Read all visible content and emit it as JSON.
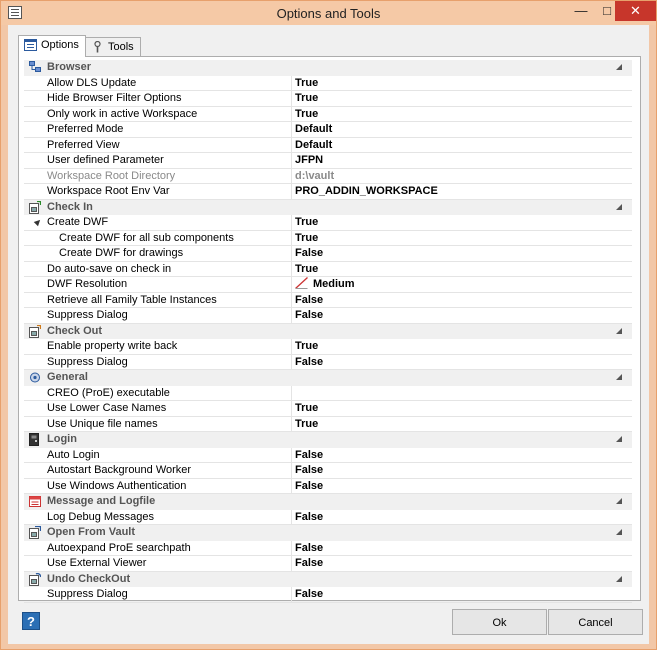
{
  "window": {
    "title": "Options and Tools"
  },
  "tabs": {
    "options": "Options",
    "tools": "Tools"
  },
  "categories": {
    "browser": "Browser",
    "checkin": "Check In",
    "checkout": "Check Out",
    "general": "General",
    "login": "Login",
    "message": "Message and Logfile",
    "openvault": "Open From Vault",
    "undo": "Undo CheckOut"
  },
  "browser": [
    {
      "name": "Allow DLS Update",
      "value": "True"
    },
    {
      "name": "Hide Browser Filter Options",
      "value": "True"
    },
    {
      "name": "Only work in active Workspace",
      "value": "True"
    },
    {
      "name": "Preferred Mode",
      "value": "Default"
    },
    {
      "name": "Preferred View",
      "value": "Default"
    },
    {
      "name": "User defined Parameter",
      "value": "JFPN"
    },
    {
      "name": "Workspace Root Directory",
      "value": "d:\\vault"
    },
    {
      "name": "Workspace Root Env Var",
      "value": "PRO_ADDIN_WORKSPACE"
    }
  ],
  "checkin": [
    {
      "name": "Create DWF",
      "value": "True"
    },
    {
      "name": "Create DWF for all sub components",
      "value": "True"
    },
    {
      "name": "Create DWF for drawings",
      "value": "False"
    },
    {
      "name": "Do auto-save on check in",
      "value": "True"
    },
    {
      "name": "DWF Resolution",
      "value": "Medium"
    },
    {
      "name": "Retrieve all Family Table Instances",
      "value": "False"
    },
    {
      "name": "Suppress Dialog",
      "value": "False"
    }
  ],
  "checkout": [
    {
      "name": "Enable property write back",
      "value": "True"
    },
    {
      "name": "Suppress Dialog",
      "value": "False"
    }
  ],
  "general": [
    {
      "name": "CREO (ProE) executable",
      "value": ""
    },
    {
      "name": "Use Lower Case Names",
      "value": "True"
    },
    {
      "name": "Use Unique file names",
      "value": "True"
    }
  ],
  "login": [
    {
      "name": "Auto Login",
      "value": "False"
    },
    {
      "name": "Autostart Background Worker",
      "value": "False"
    },
    {
      "name": "Use Windows Authentication",
      "value": "False"
    }
  ],
  "message": [
    {
      "name": "Log Debug Messages",
      "value": "False"
    }
  ],
  "openvault": [
    {
      "name": "Autoexpand ProE searchpath",
      "value": "False"
    },
    {
      "name": "Use External Viewer",
      "value": "False"
    }
  ],
  "undo": [
    {
      "name": "Suppress Dialog",
      "value": "False"
    }
  ],
  "buttons": {
    "help": "?",
    "ok": "Ok",
    "cancel": "Cancel"
  },
  "window_controls": {
    "minimize": "—",
    "maximize": "□",
    "close": "✕"
  },
  "colors": {
    "titlebar": "#f5c9a6",
    "close": "#c7362b",
    "help": "#2b6fb5"
  }
}
